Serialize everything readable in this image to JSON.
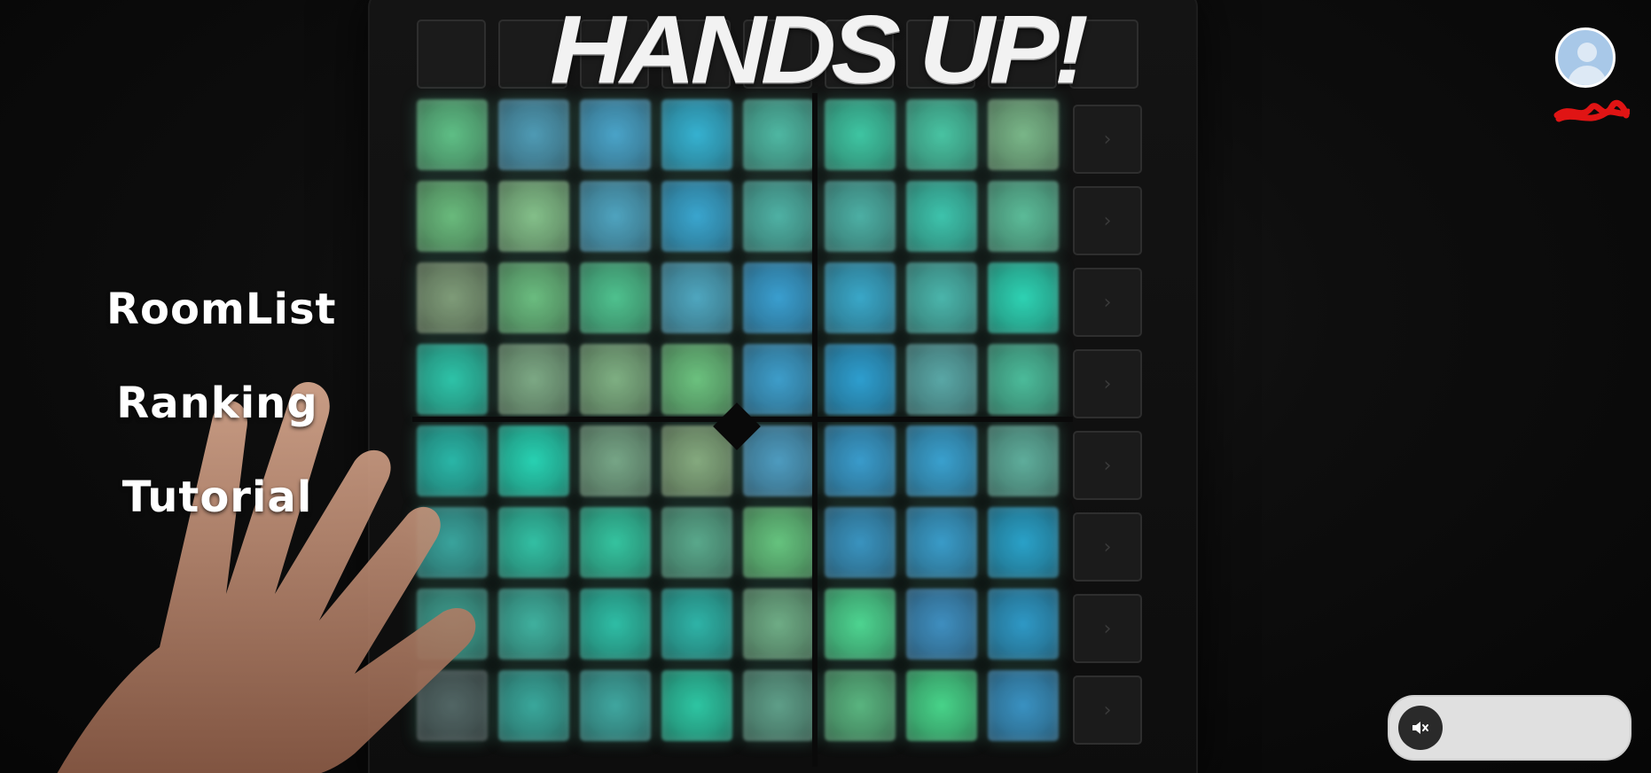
{
  "app": {
    "title": "HANDS UP!"
  },
  "menu": {
    "items": [
      {
        "label": "RoomList"
      },
      {
        "label": "Ranking"
      },
      {
        "label": "Tutorial"
      }
    ]
  },
  "user": {
    "avatar_icon": "user-avatar-icon",
    "name_obscured": true
  },
  "volume": {
    "muted": true,
    "icon": "speaker-muted-icon"
  },
  "launchpad": {
    "pad_colors": [
      [
        "#5fbf86",
        "#4f9bb5",
        "#4aa4c9",
        "#36b2d1",
        "#4fb8a3",
        "#3fc6a3",
        "#49c4a3",
        "#7ab789"
      ],
      [
        "#6abb7d",
        "#84c08a",
        "#4fa4c0",
        "#3aa6cf",
        "#4fb2a5",
        "#4db0a5",
        "#3ec4ad",
        "#5cbc99"
      ],
      [
        "#7f9c79",
        "#6bbd80",
        "#4fc28f",
        "#4fa7c0",
        "#3a9fd0",
        "#3aa8c9",
        "#4bb6ac",
        "#2ed3b4"
      ],
      [
        "#2ec4a9",
        "#7da985",
        "#7fb083",
        "#6cc27f",
        "#3e9ecb",
        "#2e9fd0",
        "#5aa8a7",
        "#4cbc9b"
      ],
      [
        "#2ab7a8",
        "#28d2b3",
        "#77a687",
        "#85aa7f",
        "#4e9cc0",
        "#3a9ccc",
        "#3aa1cf",
        "#5fae9c"
      ],
      [
        "#3aa49d",
        "#33c0a4",
        "#35c4a0",
        "#5aa98c",
        "#66c47f",
        "#3a94c0",
        "#3a9cc9",
        "#2aa2c9"
      ],
      [
        "#3f9f90",
        "#40b19f",
        "#2fbea6",
        "#2fb4a8",
        "#6fad86",
        "#4ed591",
        "#3f8fc0",
        "#2f99c6"
      ],
      [
        "#526665",
        "#3aa89c",
        "#40a7a0",
        "#2ec6a3",
        "#5f9f89",
        "#5ab580",
        "#48d48a",
        "#3a92c2"
      ]
    ]
  }
}
